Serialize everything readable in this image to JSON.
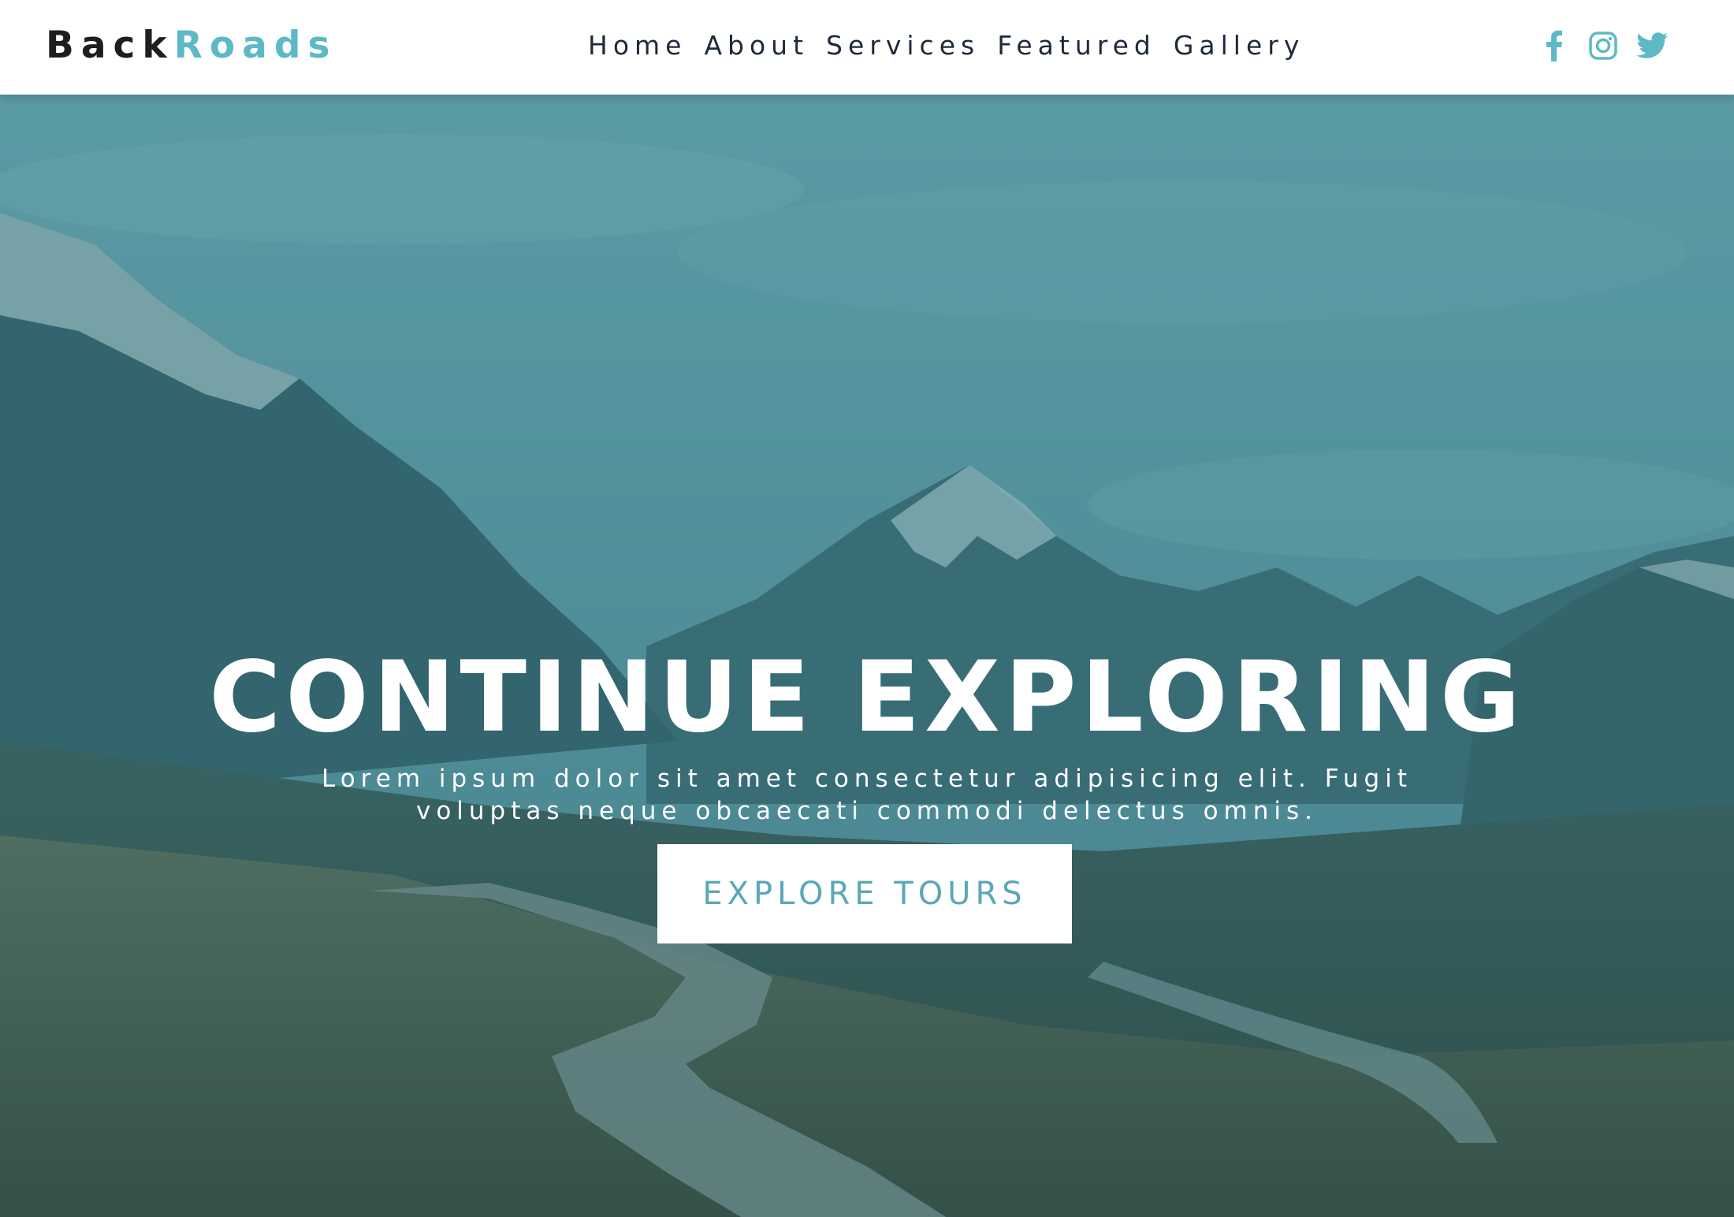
{
  "brand": {
    "part1": "Back",
    "part2": "Roads"
  },
  "nav": {
    "items": [
      {
        "label": "Home"
      },
      {
        "label": "About"
      },
      {
        "label": "Services"
      },
      {
        "label": "Featured"
      },
      {
        "label": "Gallery"
      }
    ]
  },
  "social": {
    "icons": [
      "facebook-icon",
      "instagram-icon",
      "twitter-icon"
    ]
  },
  "hero": {
    "title": "CONTINUE EXPLORING",
    "subtitle": "Lorem ipsum dolor sit amet consectetur adipisicing elit. Fugit voluptas neque obcaecati commodi delectus omnis.",
    "button_label": "EXPLORE TOURS"
  },
  "colors": {
    "brand_dark": "#1e1e1e",
    "accent": "#5eb9c6",
    "nav_text": "#1e2a3a",
    "hero_overlay": "#287882",
    "button_text": "#5aa8b6"
  }
}
